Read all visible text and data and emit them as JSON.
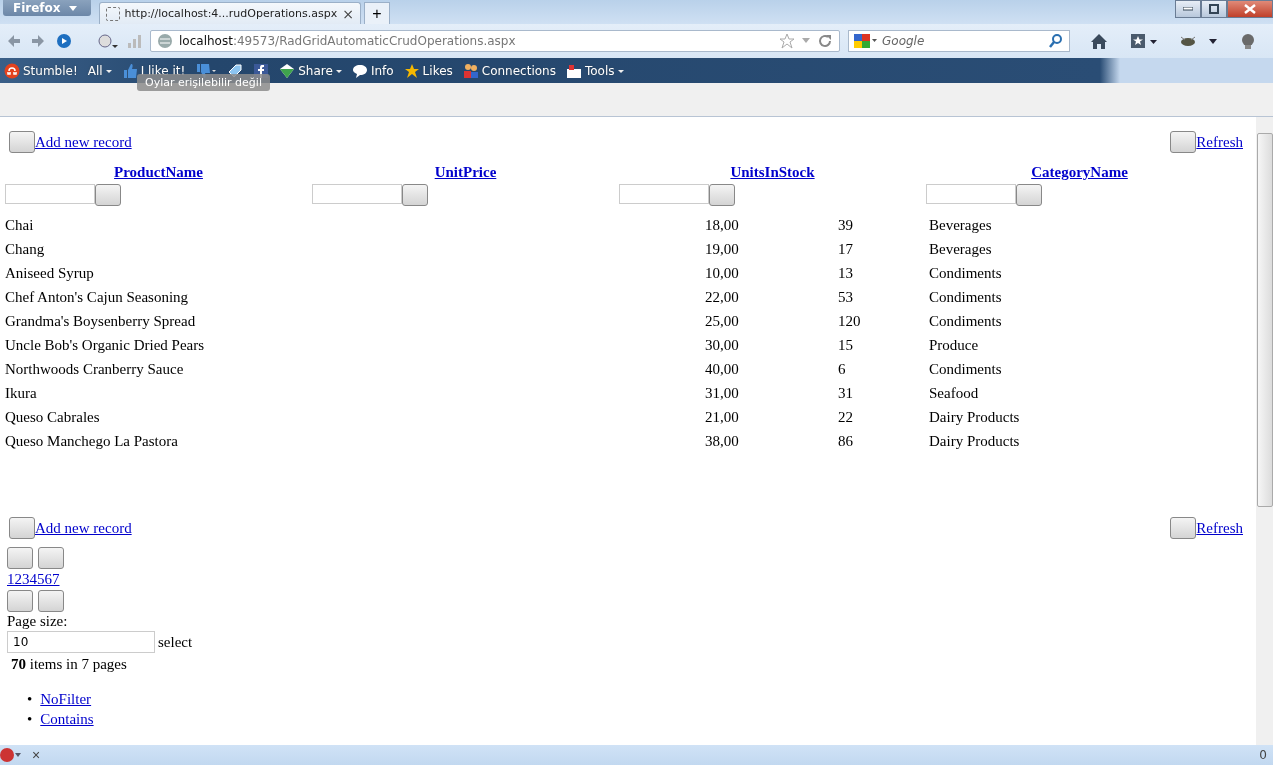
{
  "browser": {
    "menu_button": "Firefox",
    "tab_title": "http://localhost:4...rudOperations.aspx",
    "tab_close": "×",
    "new_tab": "+",
    "address_host": "localhost",
    "address_path": ":49573/RadGridAutomaticCrudOperations.aspx",
    "search_placeholder": "Google",
    "toolbar_items": [
      {
        "kind": "stumble",
        "label": "Stumble!"
      },
      {
        "kind": "menu",
        "label": "All"
      },
      {
        "kind": "like",
        "label": "I like it!"
      },
      {
        "kind": "dislike"
      },
      {
        "kind": "tag"
      },
      {
        "kind": "facebook"
      },
      {
        "kind": "share",
        "label": "Share"
      },
      {
        "kind": "info",
        "label": "Info"
      },
      {
        "kind": "likes",
        "label": "Likes"
      },
      {
        "kind": "connections",
        "label": "Connections"
      },
      {
        "kind": "tools",
        "label": "Tools"
      }
    ],
    "tooltip": "Oylar erişilebilir değil",
    "status_close": "×",
    "status_count": "0"
  },
  "grid": {
    "top_commands": {
      "add": "Add new record",
      "refresh": "Refresh"
    },
    "columns": [
      "ProductName",
      "UnitPrice",
      "UnitsInStock",
      "CategoryName"
    ],
    "rows": [
      [
        "Chai",
        "18,00",
        "39",
        "Beverages"
      ],
      [
        "Chang",
        "19,00",
        "17",
        "Beverages"
      ],
      [
        "Aniseed Syrup",
        "10,00",
        "13",
        "Condiments"
      ],
      [
        "Chef Anton's Cajun Seasoning",
        "22,00",
        "53",
        "Condiments"
      ],
      [
        "Grandma's Boysenberry Spread",
        "25,00",
        "120",
        "Condiments"
      ],
      [
        "Uncle Bob's Organic Dried Pears",
        "30,00",
        "15",
        "Produce"
      ],
      [
        "Northwoods Cranberry Sauce",
        "40,00",
        "6",
        "Condiments"
      ],
      [
        "Ikura",
        "31,00",
        "31",
        "Seafood"
      ],
      [
        "Queso Cabrales",
        "21,00",
        "22",
        "Dairy Products"
      ],
      [
        "Queso Manchego La Pastora",
        "38,00",
        "86",
        "Dairy Products"
      ]
    ],
    "bottom_commands": {
      "add": "Add new record",
      "refresh": "Refresh"
    },
    "pager": {
      "pages": "1234567",
      "page_size_label": "Page size:",
      "page_size": "10",
      "select": "select",
      "summary": "**70** items in 7 pages"
    },
    "filter_menu": [
      {
        "bullet": "•",
        "label": "NoFilter"
      },
      {
        "bullet": "•",
        "label": "Contains"
      }
    ]
  }
}
